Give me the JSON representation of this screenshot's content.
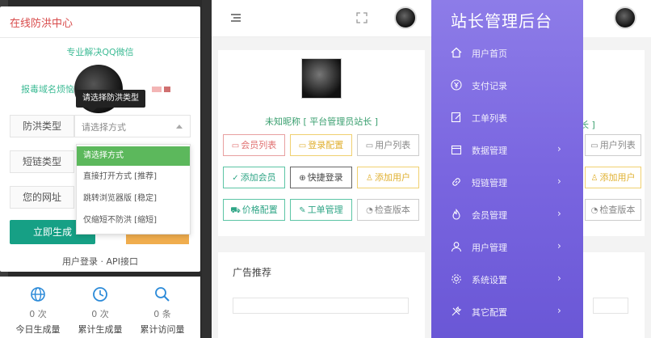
{
  "panel1": {
    "title": "在线防洪中心",
    "slogan": "专业解决QQ微信",
    "report": "报毒域名烦恼",
    "tooltip": "请选择防洪类型",
    "labels": {
      "type": "防洪类型",
      "short": "短链类型",
      "url": "您的网址"
    },
    "select_value": "请选择方式",
    "dropdown_options": [
      "请选择方式",
      "直接打开方式 [推荐]",
      "跳转浏览器版 [稳定]",
      "仅缩短不防洪 [缩短]"
    ],
    "generate_button": "立即生成",
    "footer_links": "用户登录 · API接口",
    "stats": [
      {
        "icon": "globe-icon",
        "value": "0 次",
        "label": "今日生成量"
      },
      {
        "icon": "clock-icon",
        "value": "0 次",
        "label": "累计生成量"
      },
      {
        "icon": "search-icon",
        "value": "0 条",
        "label": "累计访问量"
      }
    ]
  },
  "panel2": {
    "nickname": "未知昵称 [ 平台管理员站长 ]",
    "buttons": [
      {
        "label": "会员列表",
        "icon": "card-icon",
        "color": "red"
      },
      {
        "label": "登录配置",
        "icon": "card-icon",
        "color": "yellow"
      },
      {
        "label": "用户列表",
        "icon": "card-icon",
        "color": "gray"
      },
      {
        "label": "添加会员",
        "icon": "shield-check-icon",
        "color": "green"
      },
      {
        "label": "快捷登录",
        "icon": "plus-circle-icon",
        "color": "dark"
      },
      {
        "label": "添加用户",
        "icon": "user-icon",
        "color": "yellow"
      },
      {
        "label": "价格配置",
        "icon": "cart-icon",
        "color": "green"
      },
      {
        "label": "工单管理",
        "icon": "ticket-icon",
        "color": "green"
      },
      {
        "label": "检查版本",
        "icon": "gauge-icon",
        "color": "gray"
      }
    ],
    "ad_title": "广告推荐"
  },
  "panel3": {
    "brand": "站长管理后台",
    "nickname_fragment": "长 ]",
    "bg_buttons": [
      {
        "label": "用户列表",
        "icon": "card-icon",
        "color": "gray"
      },
      {
        "label": "添加用户",
        "icon": "user-icon",
        "color": "yellow"
      },
      {
        "label": "检查版本",
        "icon": "gauge-icon",
        "color": "gray"
      }
    ],
    "nav": [
      {
        "label": "用户首页",
        "icon": "home-icon",
        "has_children": false
      },
      {
        "label": "支付记录",
        "icon": "yen-icon",
        "has_children": false
      },
      {
        "label": "工单列表",
        "icon": "edit-icon",
        "has_children": false
      },
      {
        "label": "数据管理",
        "icon": "calendar-icon",
        "has_children": true
      },
      {
        "label": "短链管理",
        "icon": "link-icon",
        "has_children": true
      },
      {
        "label": "会员管理",
        "icon": "flame-icon",
        "has_children": true
      },
      {
        "label": "用户管理",
        "icon": "user-icon",
        "has_children": true
      },
      {
        "label": "系统设置",
        "icon": "gear-icon",
        "has_children": true
      },
      {
        "label": "其它配置",
        "icon": "tools-icon",
        "has_children": true
      }
    ]
  },
  "colors": {
    "title_red": "#d84a4a",
    "teal": "#16a085",
    "green_text": "#3dbb95",
    "dropdown_active": "#5cb85c",
    "sidebar_purple": "#7a66e0",
    "orange": "#f0ad4e"
  }
}
